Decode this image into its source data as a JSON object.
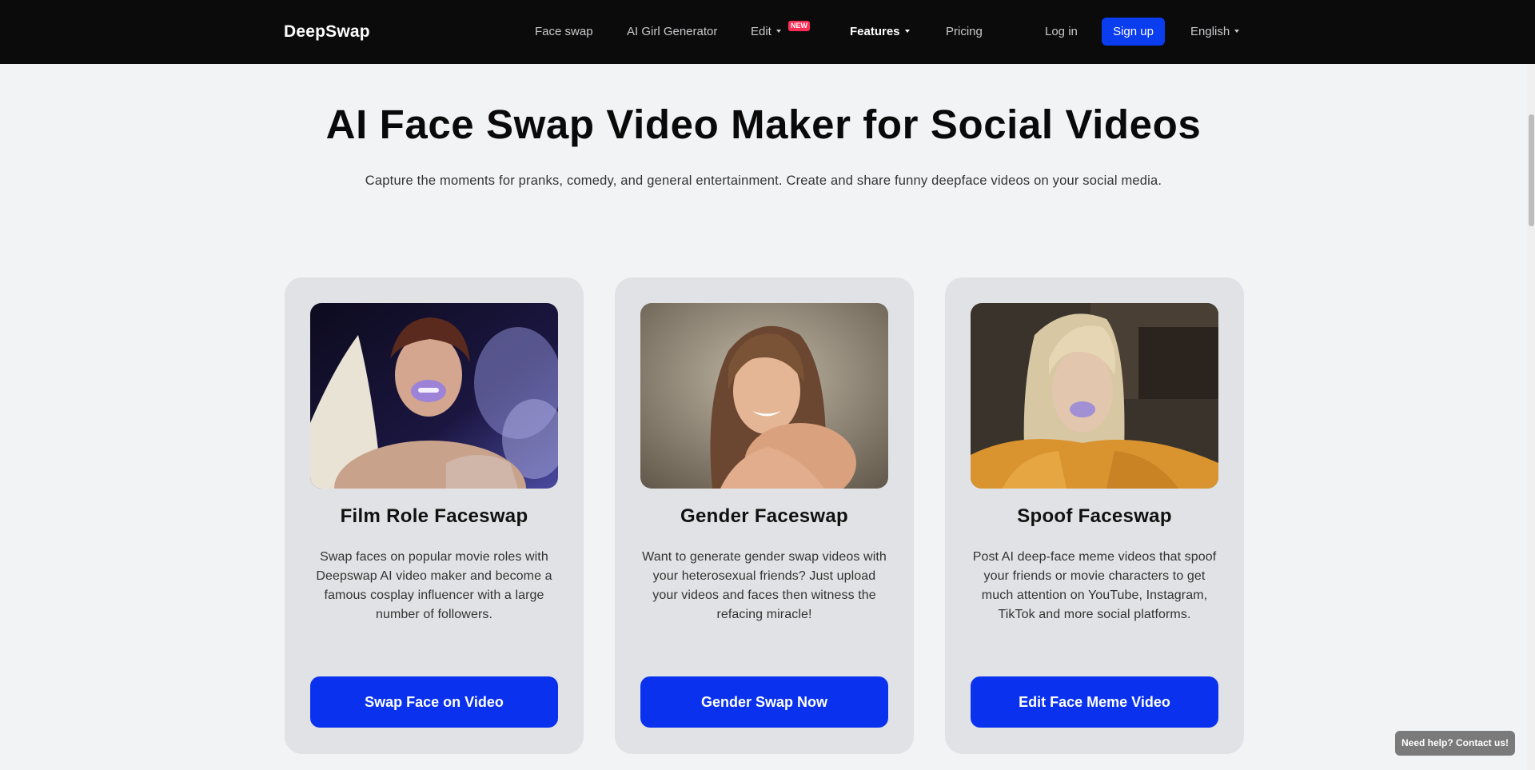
{
  "nav": {
    "logo": "DeepSwap",
    "links": {
      "face_swap": "Face swap",
      "ai_girl": "AI Girl Generator",
      "edit": "Edit",
      "edit_badge": "NEW",
      "features": "Features",
      "pricing": "Pricing",
      "login": "Log in",
      "signup": "Sign up",
      "language": "English"
    }
  },
  "hero": {
    "title": "AI Face Swap Video Maker for Social Videos",
    "subtitle": "Capture the moments for pranks, comedy, and general entertainment. Create and share funny deepface videos on your social media."
  },
  "cards": [
    {
      "title": "Film Role Faceswap",
      "description": "Swap faces on popular movie roles with Deepswap AI video maker and become a famous cosplay influencer with a large number of followers.",
      "button": "Swap Face on Video",
      "image": "film-role-photo"
    },
    {
      "title": "Gender Faceswap",
      "description": "Want to generate gender swap videos with your heterosexual friends? Just upload your videos and faces then witness the refacing miracle!",
      "button": "Gender Swap Now",
      "image": "gender-swap-photo"
    },
    {
      "title": "Spoof Faceswap",
      "description": "Post AI deep-face meme videos that spoof your friends or movie characters to get much attention on YouTube, Instagram, TikTok and more social platforms.",
      "button": "Edit Face Meme Video",
      "image": "spoof-photo"
    }
  ],
  "help": {
    "label": "Need help? Contact us!"
  },
  "colors": {
    "nav_bg": "#0b0b0c",
    "accent": "#0a32ee",
    "badge": "#ff2d55",
    "page_bg": "#f2f3f5",
    "card_bg": "#e1e2e5"
  }
}
